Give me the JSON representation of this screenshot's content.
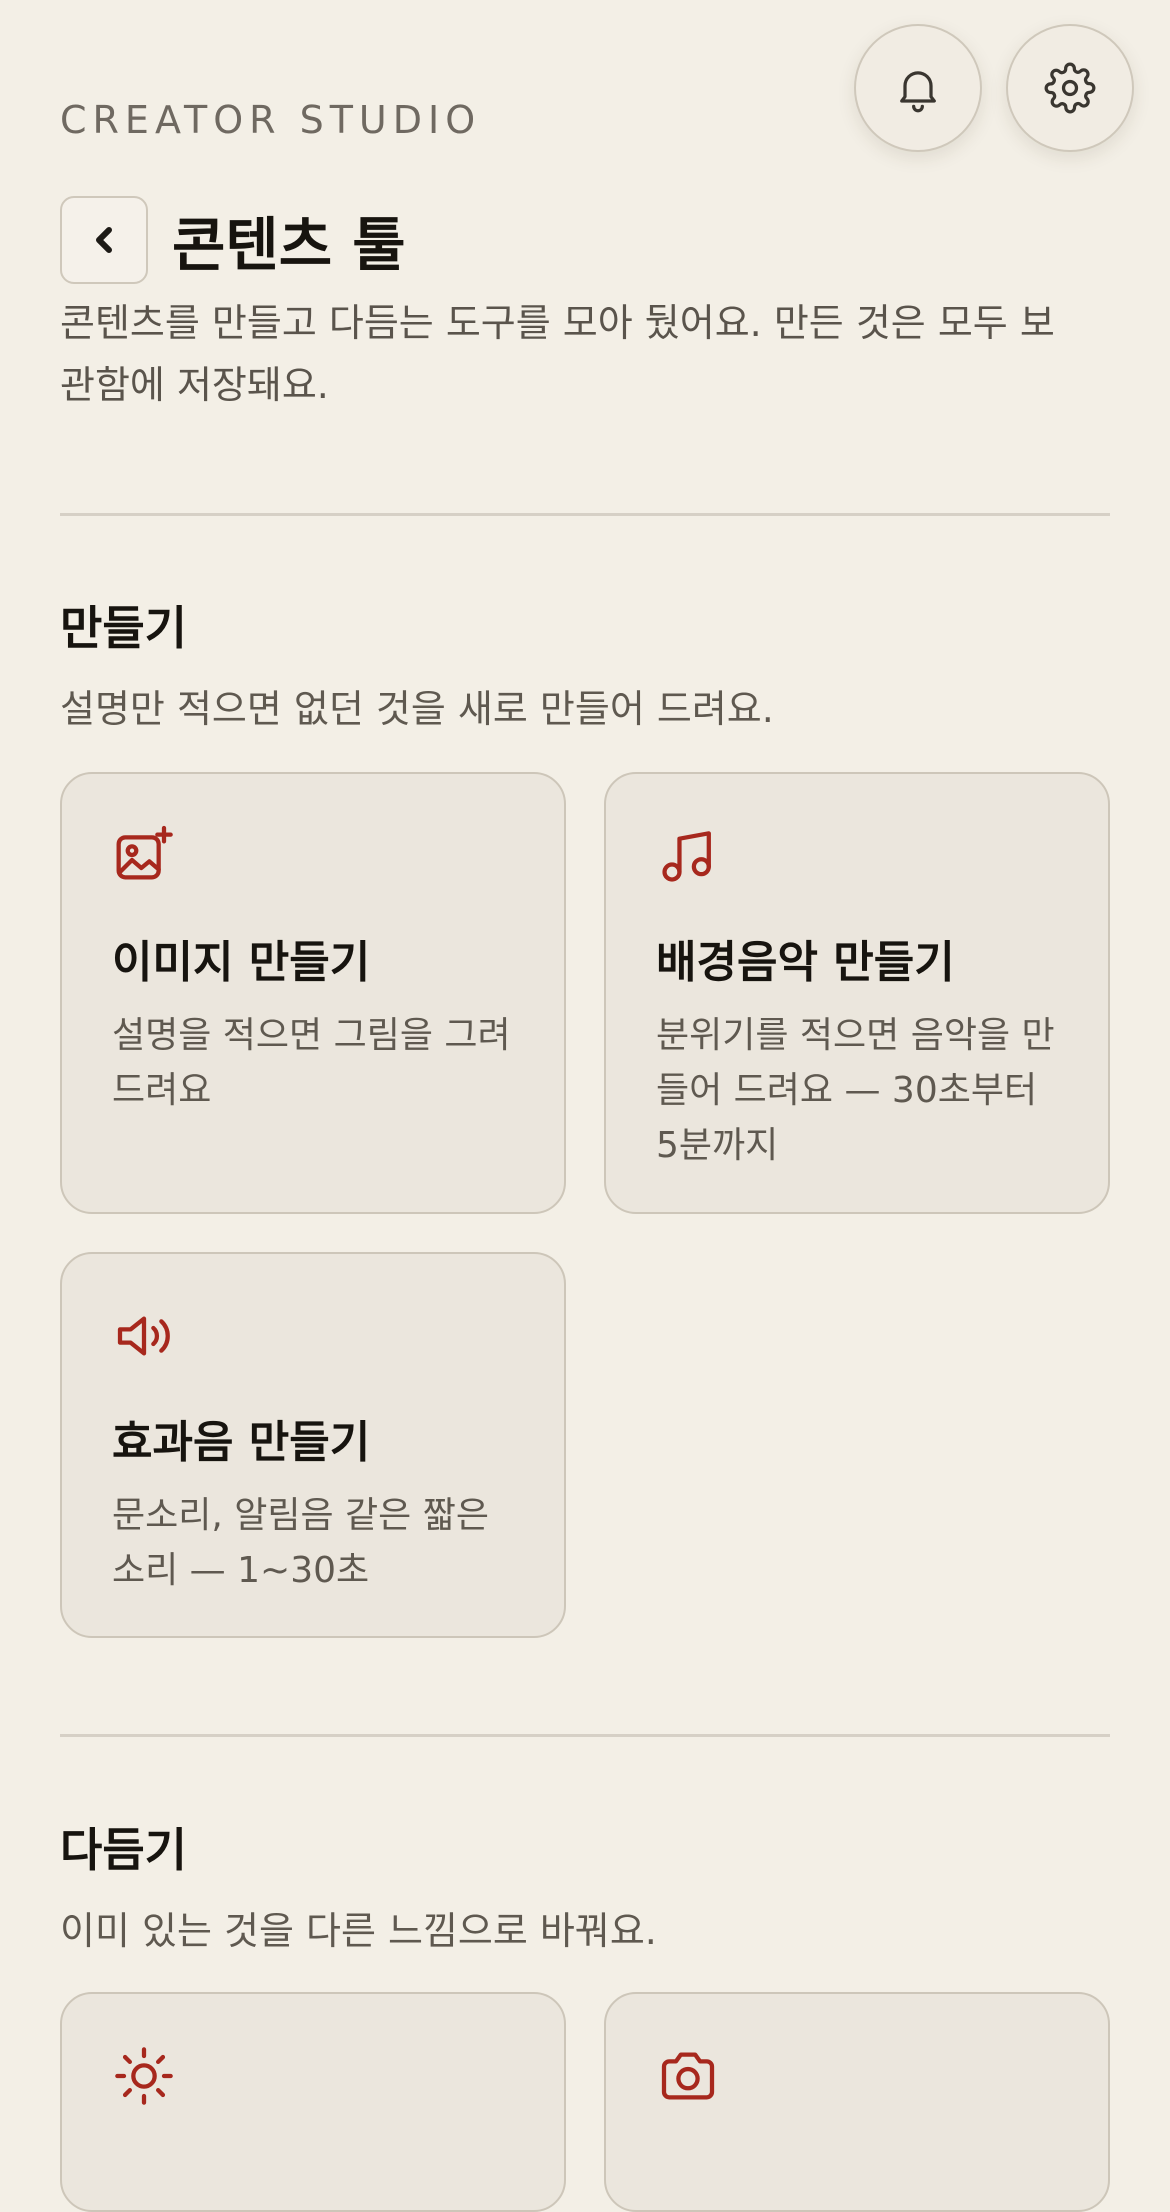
{
  "header": {
    "eyebrow": "CREATOR STUDIO",
    "title": "콘텐츠 툴",
    "description": "콘텐츠를 만들고 다듬는 도구를 모아 뒀어요. 만든 것은 모두 보관함에 저장돼요."
  },
  "icons": {
    "back": "chevron-left",
    "notifications": "bell",
    "settings": "gear"
  },
  "accent_color": "#a7281d",
  "sections": [
    {
      "title": "만들기",
      "description": "설명만 적으면 없던 것을 새로 만들어 드려요.",
      "cards": [
        {
          "icon": "image-sparkle",
          "title": "이미지 만들기",
          "description": "설명을 적으면 그림을 그려 드려요"
        },
        {
          "icon": "music-note",
          "title": "배경음악 만들기",
          "description": "분위기를 적으면 음악을 만들어 드려요 — 30초부터 5분까지"
        },
        {
          "icon": "speaker",
          "title": "효과음 만들기",
          "description": "문소리, 알림음 같은 짧은 소리 — 1~30초"
        }
      ]
    },
    {
      "title": "다듬기",
      "description": "이미 있는 것을 다른 느낌으로 바꿔요.",
      "cards": [
        {
          "icon": "sun"
        },
        {
          "icon": "camera"
        }
      ]
    }
  ]
}
